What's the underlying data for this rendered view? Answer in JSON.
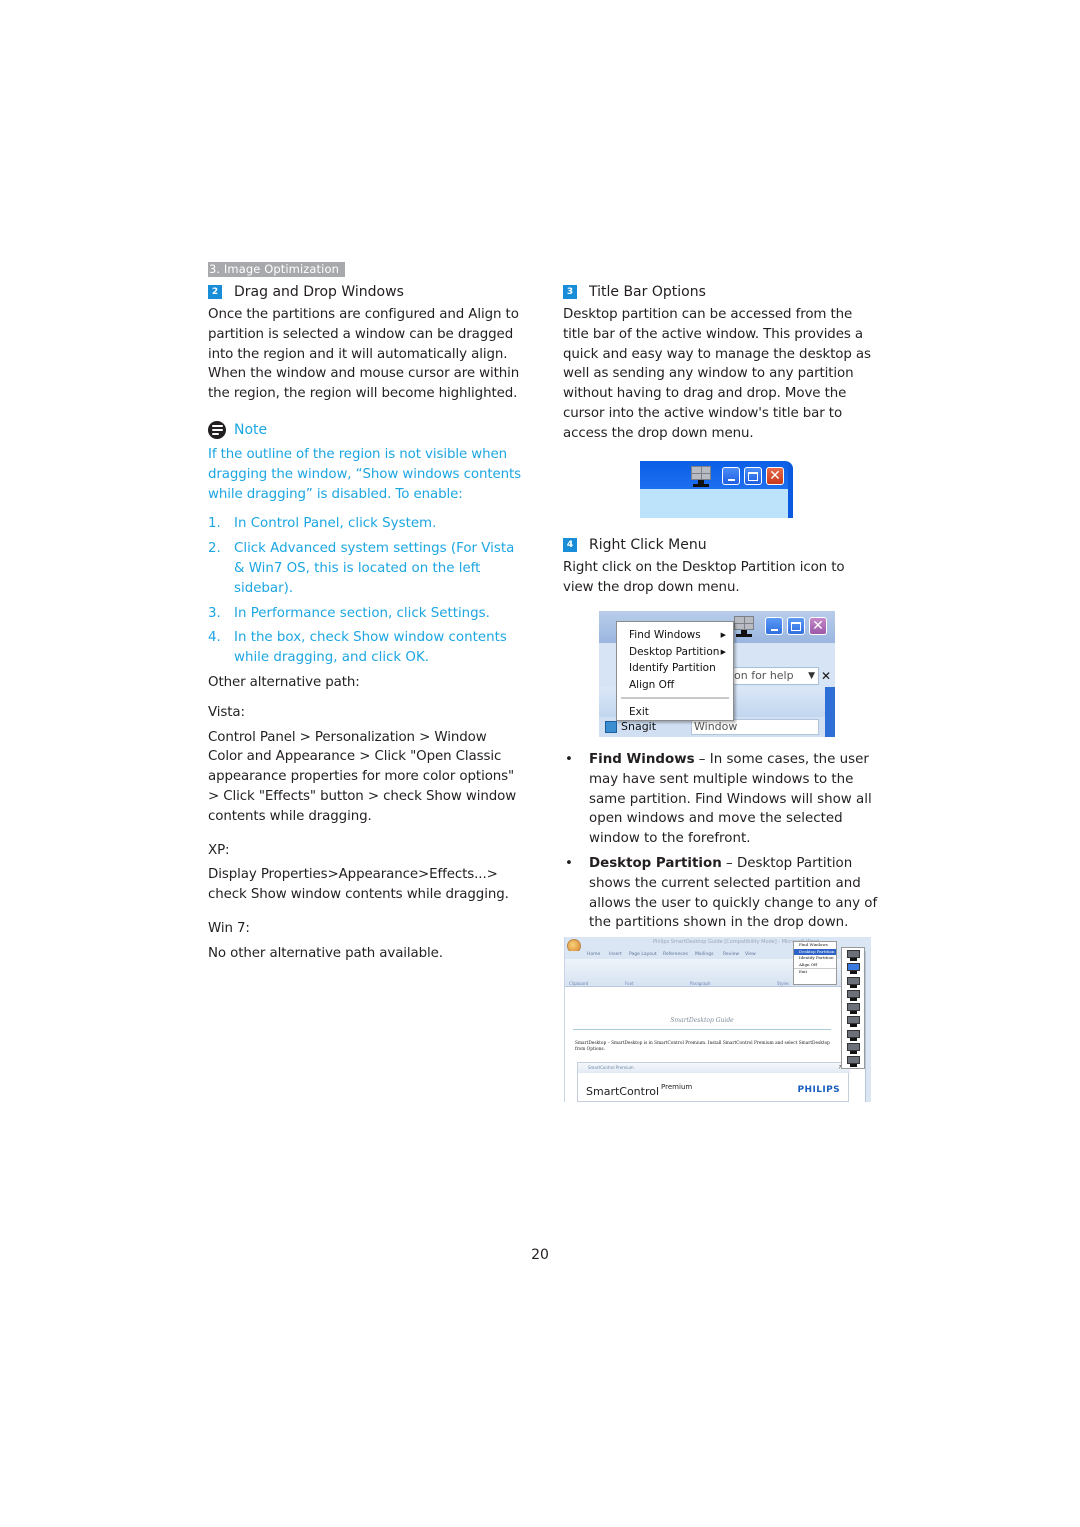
{
  "section_tag": "3. Image Optimization",
  "left": {
    "drag_drop": {
      "badge": "2",
      "title": "Drag and Drop Windows",
      "body": "Once the partitions are configured and Align to partition is selected a window can be dragged into the region and it will automatically align. When the window and mouse cursor are within the region, the region will become highlighted."
    },
    "note": {
      "label": "Note",
      "intro": "If the outline of the region is not visible when dragging the window, “Show windows contents while dragging” is disabled. To enable:",
      "steps": [
        {
          "n": "1.",
          "text": "In Control Panel, click System."
        },
        {
          "n": "2.",
          "text": "Click Advanced system settings  (For Vista & Win7 OS, this is located on the left sidebar)."
        },
        {
          "n": "3.",
          "text": "In Performance section, click Settings."
        },
        {
          "n": "4.",
          "text": "In the box, check Show window contents while dragging, and click OK."
        }
      ]
    },
    "alt_path": {
      "heading": "Other alternative path:",
      "vista_label": "Vista:",
      "vista_text": "Control Panel > Personalization > Window Color and Appearance > Click \"Open Classic appearance properties for more color options\" > Click \"Effects\" button > check Show window contents while dragging.",
      "xp_label": "XP:",
      "xp_text": "Display Properties>Appearance>Effects...> check Show window contents while dragging.",
      "win7_label": "Win 7:",
      "win7_text": "No other alternative path available."
    }
  },
  "right": {
    "title_bar": {
      "badge": "3",
      "title": "Title Bar Options",
      "body": "Desktop partition can be accessed from the title bar of the active window. This provides a quick and easy way to manage the desktop as well as sending any window to any partition without having to drag and drop.  Move the cursor into the active window's title bar to access the drop down menu."
    },
    "right_click": {
      "badge": "4",
      "title": "Right Click Menu",
      "body": "Right click on the Desktop Partition icon to view the drop down menu."
    },
    "context_menu": {
      "items": [
        "Find Windows",
        "Desktop Partition",
        "Identify Partition",
        "Align Off"
      ],
      "exit": "Exit",
      "help_box": "on for help",
      "snagit": "Snagit",
      "window_box": "Window"
    },
    "bullets": [
      {
        "term": "Find Windows",
        "text": " – In some cases, the user may have sent multiple windows to the same partition.  Find Windows will show all open windows and move the selected window to the forefront."
      },
      {
        "term": "Desktop Partition",
        "text": " – Desktop Partition shows the current selected partition and allows the user to quickly change to any of the partitions shown in the drop down."
      }
    ],
    "word_shot": {
      "window_title": "Philips SmartDesktop Guide [Compatibility Mode] - Microsoft Word",
      "tabs": [
        "Home",
        "Insert",
        "Page Layout",
        "References",
        "Mailings",
        "Review",
        "View"
      ],
      "groups": [
        "Clipboard",
        "Font",
        "Paragraph",
        "Styles"
      ],
      "menu_items": [
        "Find Windows",
        "Desktop Partition",
        "Identify Partition",
        "Align Off",
        "Exit"
      ],
      "doc_title": "SmartDesktop Guide",
      "doc_body": "SmartDesktop – SmartDesktop is in SmartControl Premium.  Install SmartControl Premium and select SmartDesktop from Options.",
      "panel_title": "SmartControl Premium",
      "brand_name": "SmartControl",
      "brand_sup": "Premium",
      "logo": "PHILIPS"
    }
  },
  "page_number": "20"
}
